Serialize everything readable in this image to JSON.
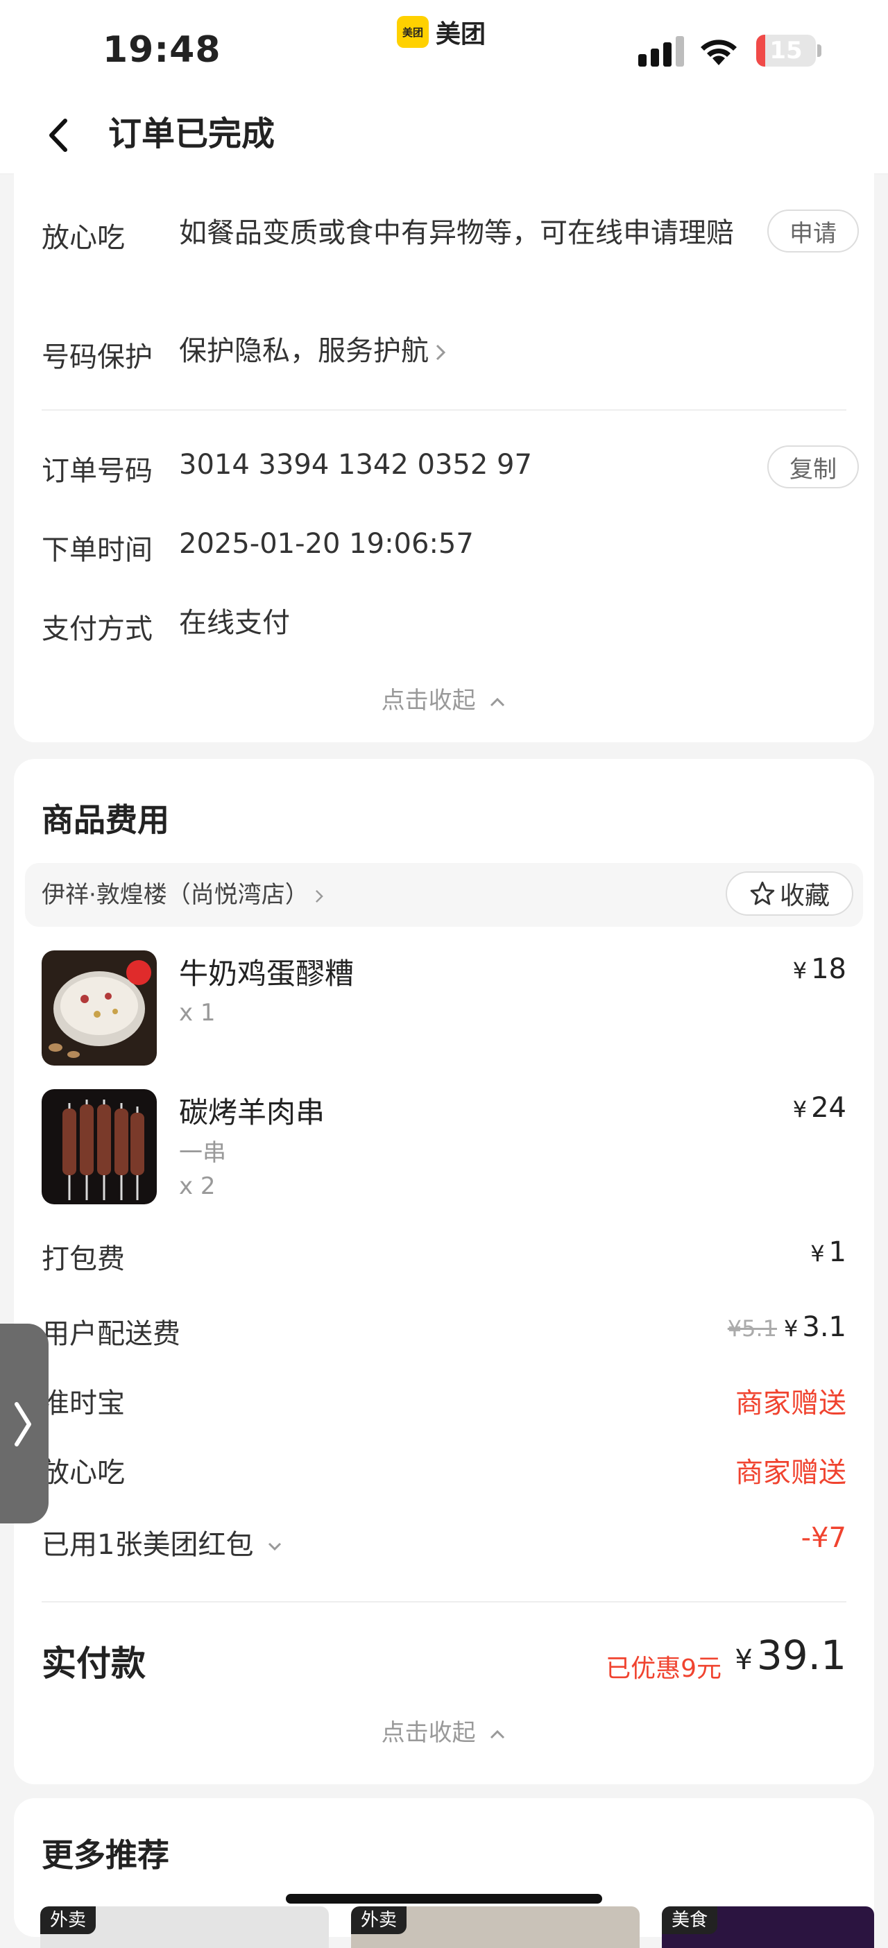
{
  "status_bar": {
    "time": "19:48",
    "app_name": "美团",
    "app_badge": "美团",
    "battery_level": "15",
    "battery_fraction": 0.15
  },
  "nav": {
    "title": "订单已完成",
    "back_icon": "chevron-left-icon"
  },
  "order_info": {
    "rows": [
      {
        "label": "放心吃",
        "value": "如餐品变质或食中有异物等，可在线申请理赔",
        "button": "申请"
      },
      {
        "label": "号码保护",
        "value": "保护隐私，服务护航"
      },
      {
        "label": "订单号码",
        "value": "3014 3394 1342 0352 97",
        "button": "复制"
      },
      {
        "label": "下单时间",
        "value": "2025-01-20 19:06:57"
      },
      {
        "label": "支付方式",
        "value": "在线支付"
      }
    ],
    "collapse_label": "点击收起"
  },
  "goods": {
    "title": "商品费用",
    "shop_name": "伊祥·敦煌楼（尚悦湾店）",
    "favorite_label": "收藏",
    "items": [
      {
        "name": "牛奶鸡蛋醪糟",
        "qty": "x 1",
        "spec": "",
        "currency": "¥",
        "price": "18"
      },
      {
        "name": "碳烤羊肉串",
        "spec": "一串",
        "qty": "x 2",
        "currency": "¥",
        "price": "24"
      }
    ],
    "fees": [
      {
        "label": "打包费",
        "currency": "¥",
        "value": "1"
      },
      {
        "label": "用户配送费",
        "original": "¥5.1",
        "currency": "¥",
        "value": "3.1"
      },
      {
        "label": "准时宝",
        "value": "商家赠送"
      },
      {
        "label": "放心吃",
        "value": "商家赠送"
      },
      {
        "label": "已用1张美团红包",
        "value": "-¥7"
      }
    ],
    "total_label": "实付款",
    "saved_text": "已优惠9元",
    "total_currency": "¥",
    "total_value": "39.1",
    "collapse_label": "点击收起"
  },
  "recommendations": {
    "title": "更多推荐",
    "tags": [
      "外卖",
      "外卖",
      "美食"
    ]
  },
  "colors": {
    "accent_red": "#f0432f",
    "brand_yellow": "#ffd100",
    "battery_red": "#f04a48"
  }
}
